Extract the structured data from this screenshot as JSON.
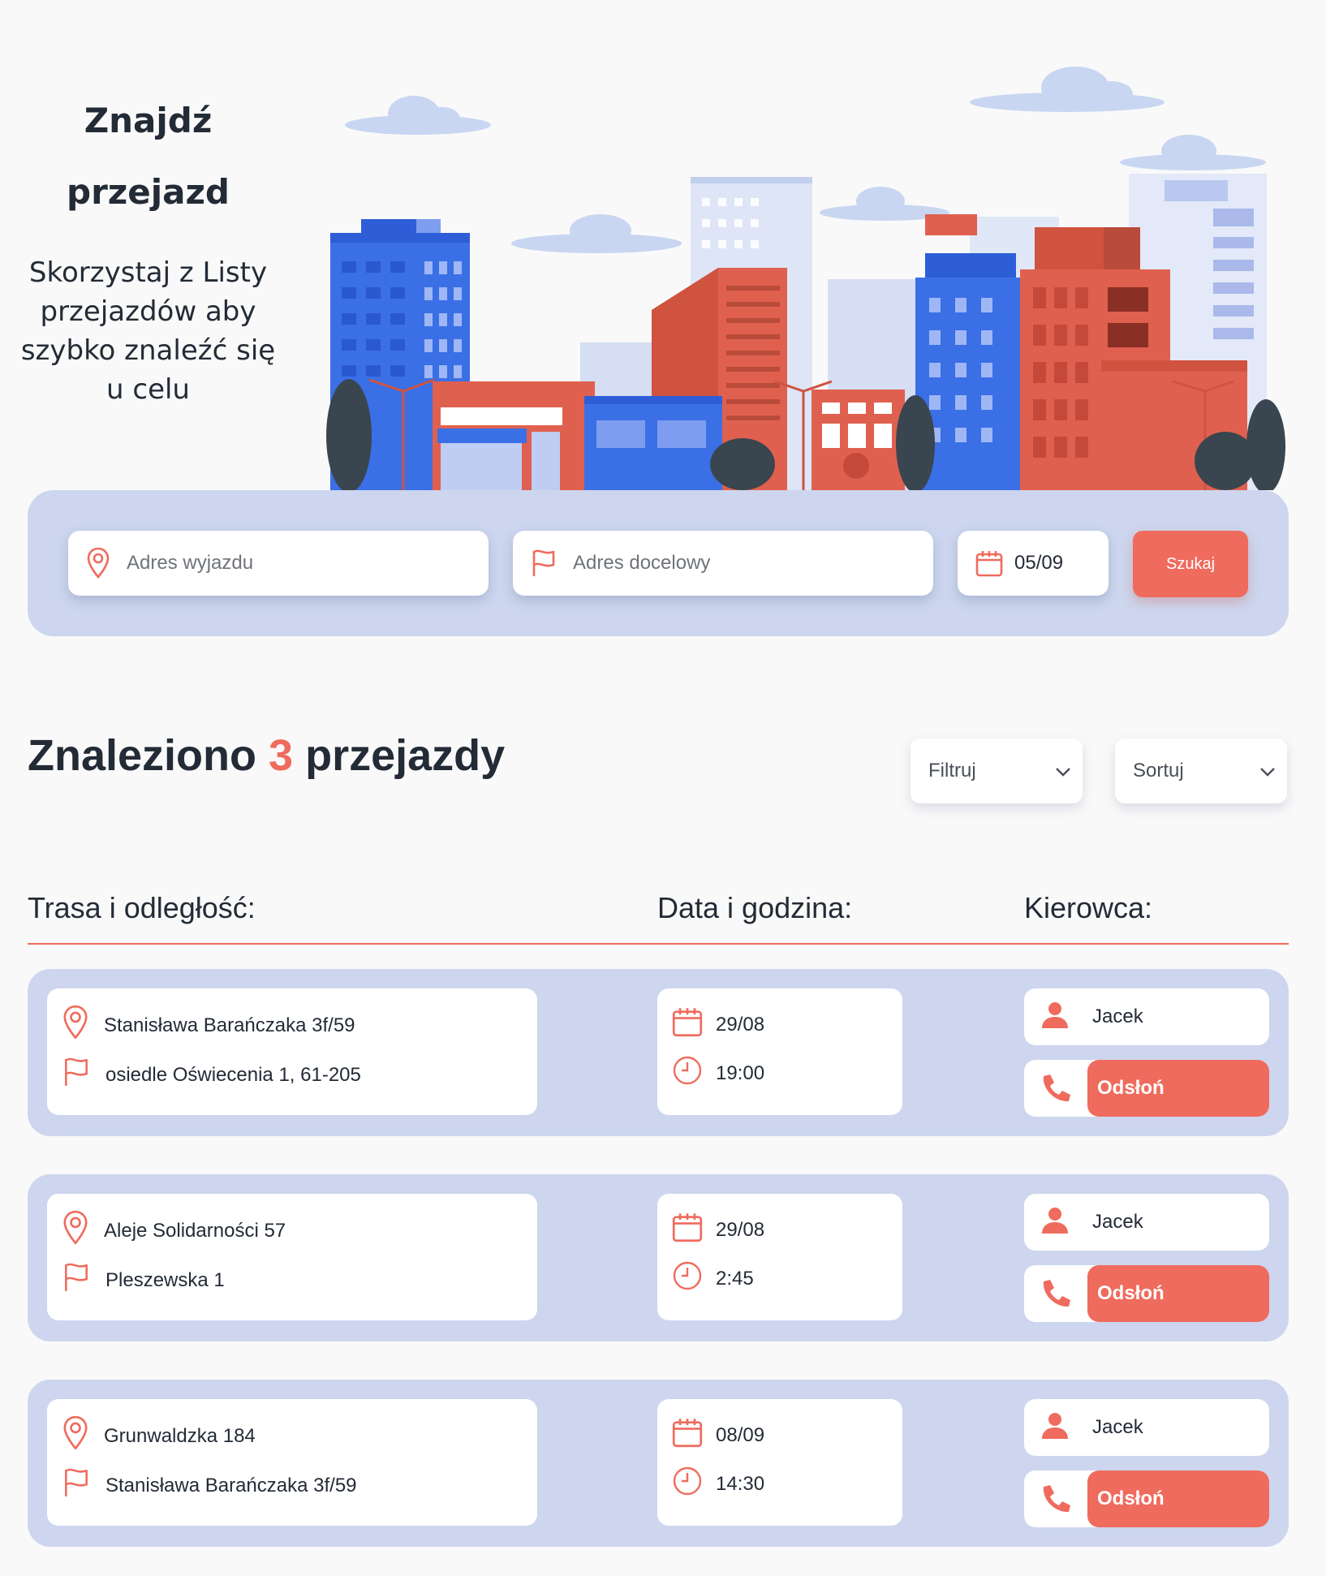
{
  "hero": {
    "title_line1": "Znajdź",
    "title_line2": "przejazd",
    "subtitle": "Skorzystaj z Listy przejazdów aby szybko znaleźć się u celu"
  },
  "search": {
    "departure_placeholder": "Adres wyjazdu",
    "destination_placeholder": "Adres docelowy",
    "date": "05/09",
    "button_label": "Szukaj"
  },
  "results": {
    "prefix": "Znaleziono",
    "count": "3",
    "suffix": "przejazdy",
    "filter_label": "Filtruj",
    "sort_label": "Sortuj"
  },
  "columns": {
    "route": "Trasa i odległość:",
    "datetime": "Data i godzina:",
    "driver": "Kierowca:"
  },
  "rides": [
    {
      "from": "Stanisława Barańczaka 3f/59",
      "to": "osiedle Oświecenia 1, 61-205",
      "date": "29/08",
      "time": "19:00",
      "driver": "Jacek",
      "reveal_label": "Odsłoń"
    },
    {
      "from": "Aleje Solidarności 57",
      "to": "Pleszewska 1",
      "date": "29/08",
      "time": "2:45",
      "driver": "Jacek",
      "reveal_label": "Odsłoń"
    },
    {
      "from": "Grunwaldzka 184",
      "to": "Stanisława Barańczaka 3f/59",
      "date": "08/09",
      "time": "14:30",
      "driver": "Jacek",
      "reveal_label": "Odsłoń"
    }
  ],
  "colors": {
    "accent": "#ef6b5d",
    "panel": "#cdd6ee",
    "text": "#232b36",
    "building_blue": "#3a6fe6",
    "building_red": "#e0604f"
  },
  "icons": {
    "departure": "location-pin-icon",
    "destination": "flag-icon",
    "date": "calendar-icon",
    "time": "clock-icon",
    "driver": "user-icon",
    "phone": "phone-icon",
    "dropdown": "chevron-down-icon"
  }
}
